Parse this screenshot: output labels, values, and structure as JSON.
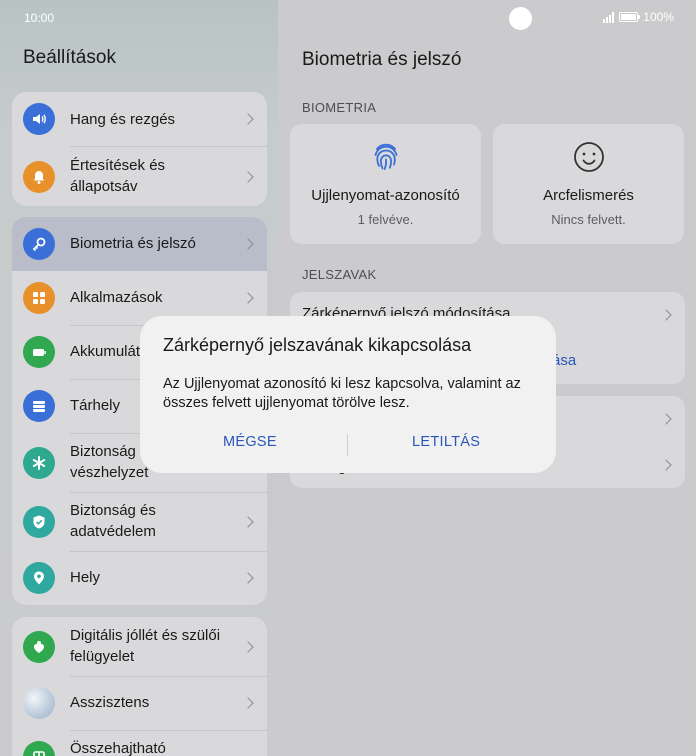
{
  "status_bar": {
    "time": "10:00",
    "battery": "100%"
  },
  "left": {
    "title": "Beállítások",
    "items": [
      {
        "label": "Hang és rezgés",
        "icon": "speaker-icon",
        "color": "#3a6fd8"
      },
      {
        "label": "Értesítések és állapotsáv",
        "icon": "bell-icon",
        "color": "#e8902a"
      },
      {
        "label": "Biometria és jelszó",
        "icon": "key-icon",
        "color": "#3a6fd8"
      },
      {
        "label": "Alkalmazások",
        "icon": "apps-grid-icon",
        "color": "#e8902a"
      },
      {
        "label": "Akkumulátor",
        "icon": "battery-icon",
        "color": "#2fa84f"
      },
      {
        "label": "Tárhely",
        "icon": "storage-icon",
        "color": "#3a6fd8"
      },
      {
        "label": "Biztonság és vészhelyzet",
        "icon": "asterisk-icon",
        "color": "#2fa890"
      },
      {
        "label": "Biztonság és adatvédelem",
        "icon": "shield-icon",
        "color": "#2fa8a0"
      },
      {
        "label": "Hely",
        "icon": "location-pin-icon",
        "color": "#2fa8a0"
      },
      {
        "label": "Digitális jóllét és szülői felügyelet",
        "icon": "heart-person-icon",
        "color": "#2fa84f"
      },
      {
        "label": "Asszisztens",
        "icon": "assistant-orb-icon",
        "color": "#c8d8e8"
      },
      {
        "label": "Összehajtható",
        "icon": "fold-icon",
        "color": "#2fa84f"
      }
    ]
  },
  "right": {
    "title": "Biometria és jelszó",
    "biometrics_section": "BIOMETRIA",
    "fingerprint": {
      "title": "Ujjlenyomat-azonosító",
      "subtitle": "1 felvéve."
    },
    "face": {
      "title": "Arcfelismerés",
      "subtitle": "Nincs felvett."
    },
    "passwords_section": "JELSZAVAK",
    "change_lock_password": "Zárképernyő jelszó módosítása",
    "link_fragment": "ása",
    "row_fragment": "g"
  },
  "dialog": {
    "title": "Zárképernyő jelszavának kikapcsolása",
    "message": "Az Ujjlenyomat azonosító ki lesz kapcsolva, valamint az összes felvett ujjlenyomat törölve lesz.",
    "cancel": "MÉGSE",
    "confirm": "LETILTÁS"
  }
}
